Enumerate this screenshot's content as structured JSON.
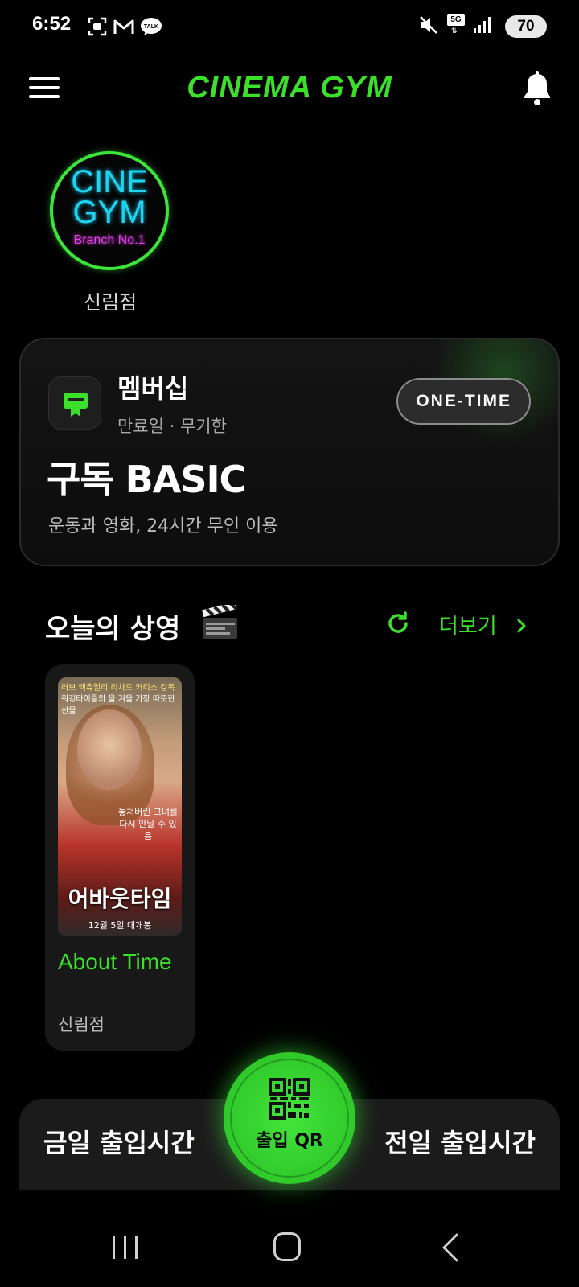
{
  "status_bar": {
    "time": "6:52",
    "notification_icons": [
      "screenshot-icon",
      "gmail-icon",
      "talk-icon"
    ],
    "talk_label": "TALK",
    "network_label": "5G",
    "battery": "70"
  },
  "header": {
    "title": "CINEMA GYM",
    "accent_color": "#3be02a"
  },
  "branch": {
    "logo_line1": "CINE",
    "logo_line2": "GYM",
    "logo_line3": "Branch No.1",
    "name": "신림점"
  },
  "membership": {
    "title": "멤버십",
    "expiry": "만료일 · 무기한",
    "badge": "ONE-TIME",
    "plan": "구독 BASIC",
    "description": "운동과 영화, 24시간 무인 이용"
  },
  "screening": {
    "title": "오늘의 상영",
    "more_label": "더보기",
    "movies": [
      {
        "title": "About Time",
        "branch": "신림점",
        "poster_title": "어바웃타임",
        "poster_date": "12월 5일 대개봉",
        "poster_tagline": "놓쳐버린 그녀를 다시 만날 수 있음",
        "poster_credits": "러브 액츄얼리 리차드 커티스 감독",
        "poster_subline": "워킹타이틀의 올 겨울 가장 따뜻한 선물"
      }
    ]
  },
  "bottom_bar": {
    "left_label": "금일 출입시간",
    "qr_label": "출입 QR",
    "right_label": "전일 출입시간"
  }
}
